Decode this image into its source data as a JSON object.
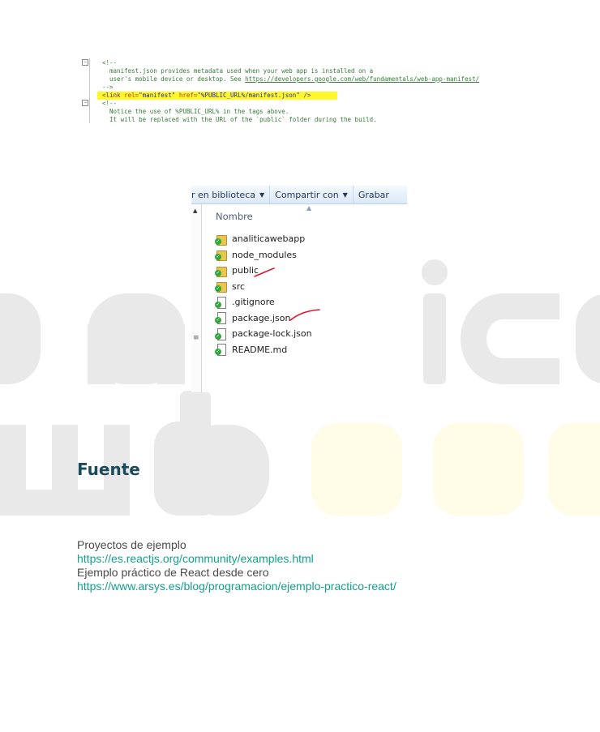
{
  "code_snippet": {
    "lines": [
      "<!--",
      "  manifest.json provides metadata used when your web app is installed on a",
      "  user's mobile device or desktop. See ",
      "-->",
      "<link rel=\"manifest\" href=\"%PUBLIC_URL%/manifest.json\" />",
      "<!--",
      "  Notice the use of %PUBLIC_URL% in the tags above.",
      "  It will be replaced with the URL of the `public` folder during the build."
    ],
    "link_text": "https://developers.google.com/web/fundamentals/web-app-manifest/",
    "highlight_tag": "<link ",
    "highlight_attr1": "rel=",
    "highlight_val1": "\"manifest\"",
    "highlight_attr2": "href=",
    "highlight_val2": "\"%PUBLIC_URL%/manifest.json\"",
    "highlight_end": " />",
    "highlight_color": "#fff82a"
  },
  "explorer": {
    "toolbar": {
      "include_label": "r en biblioteca",
      "share_label": "Compartir con",
      "burn_label": "Grabar"
    },
    "column_header": "Nombre",
    "files": [
      {
        "name": "analiticawebapp",
        "type": "folder",
        "icon": "folder-icon"
      },
      {
        "name": "node_modules",
        "type": "folder",
        "icon": "folder-icon"
      },
      {
        "name": "public",
        "type": "folder",
        "icon": "folder-icon",
        "annotated": true
      },
      {
        "name": "src",
        "type": "folder",
        "icon": "folder-icon"
      },
      {
        "name": ".gitignore",
        "type": "file",
        "icon": "file-icon"
      },
      {
        "name": "package.json",
        "type": "file",
        "icon": "file-icon",
        "annotated": true
      },
      {
        "name": "package-lock.json",
        "type": "file",
        "icon": "file-icon"
      },
      {
        "name": "README.md",
        "type": "file",
        "icon": "file-icon"
      }
    ],
    "annotation_color": "#e0162b"
  },
  "section": {
    "heading": "Fuente",
    "heading_color": "#1b4a5a",
    "references": [
      {
        "text": "Proyectos de ejemplo",
        "url": "https://es.reactjs.org/community/examples.html"
      },
      {
        "text": "Ejemplo práctico de React desde cero",
        "url": "https://www.arsys.es/blog/programacion/ejemplo-practico-react/"
      }
    ],
    "link_color": "#12a08c"
  },
  "watermark": {
    "top_text": "analitica",
    "bottom_text": "web"
  }
}
